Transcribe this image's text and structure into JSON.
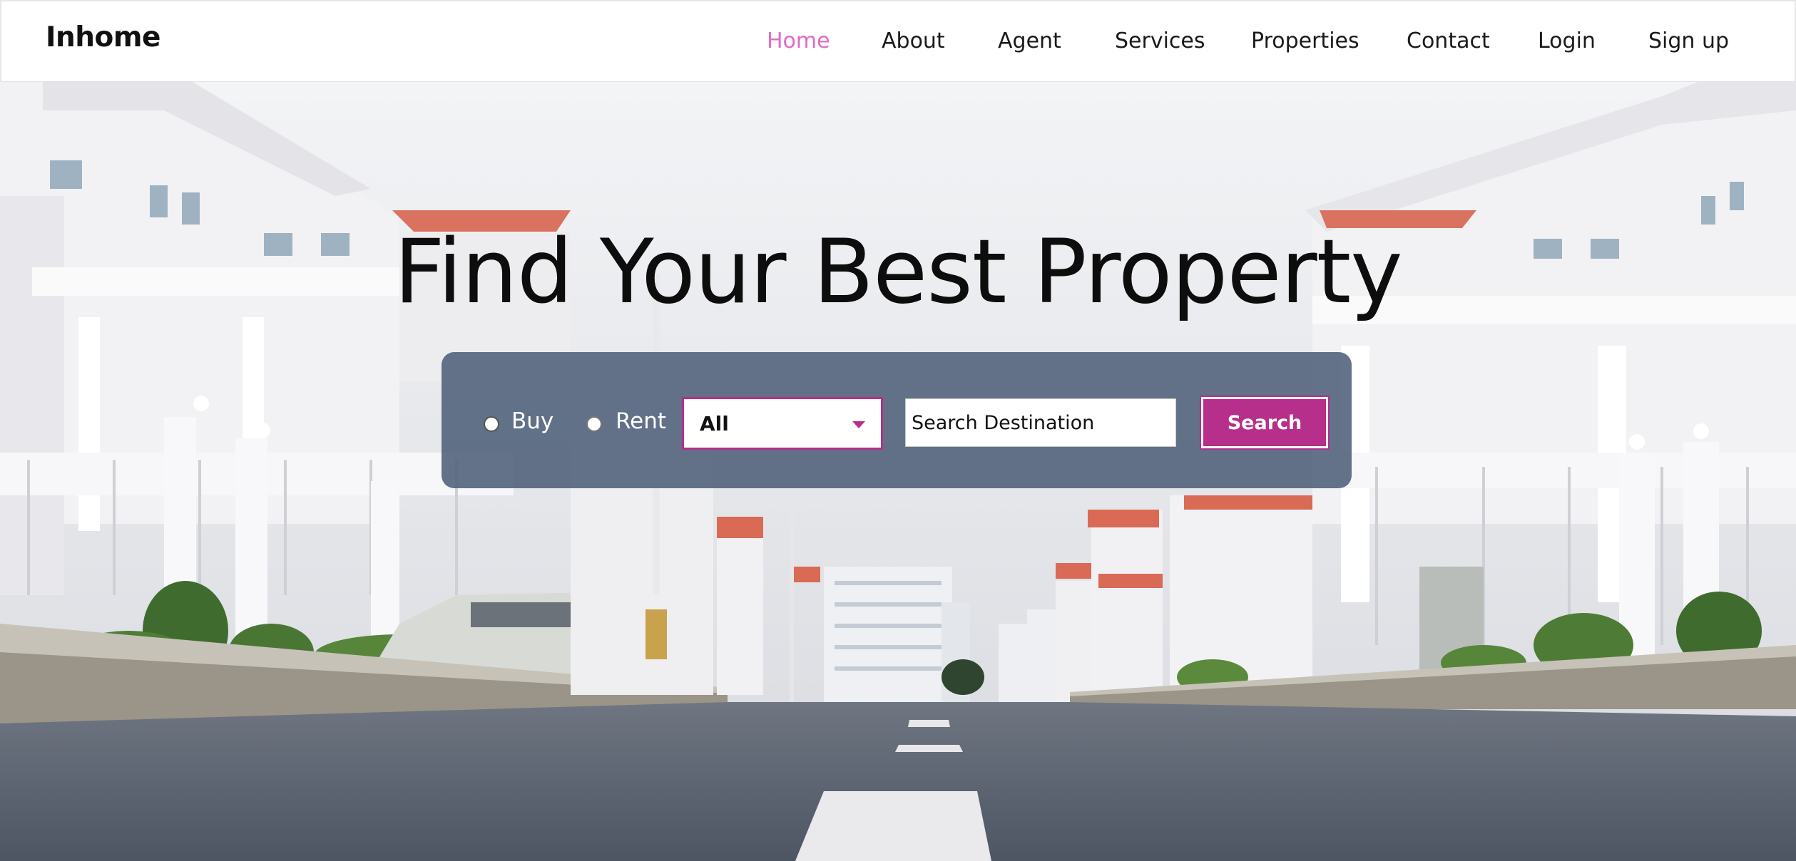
{
  "brand": "Inhome",
  "nav": {
    "items": [
      {
        "label": "Home",
        "active": true
      },
      {
        "label": "About",
        "active": false
      },
      {
        "label": "Agent",
        "active": false
      },
      {
        "label": "Services",
        "active": false
      },
      {
        "label": "Properties",
        "active": false
      },
      {
        "label": "Contact",
        "active": false
      },
      {
        "label": "Login",
        "active": false
      },
      {
        "label": "Sign up",
        "active": false
      }
    ]
  },
  "hero": {
    "title": "Find Your Best Property",
    "background_image": "residential street lined with white villas"
  },
  "search": {
    "radio_buy_label": "Buy",
    "radio_rent_label": "Rent",
    "type_select_value": "All",
    "destination_placeholder": "Search Destination",
    "button_label": "Search"
  },
  "colors": {
    "accent": "#b52f8b",
    "nav_active": "#e06bc7",
    "panel": "#4e6079"
  }
}
